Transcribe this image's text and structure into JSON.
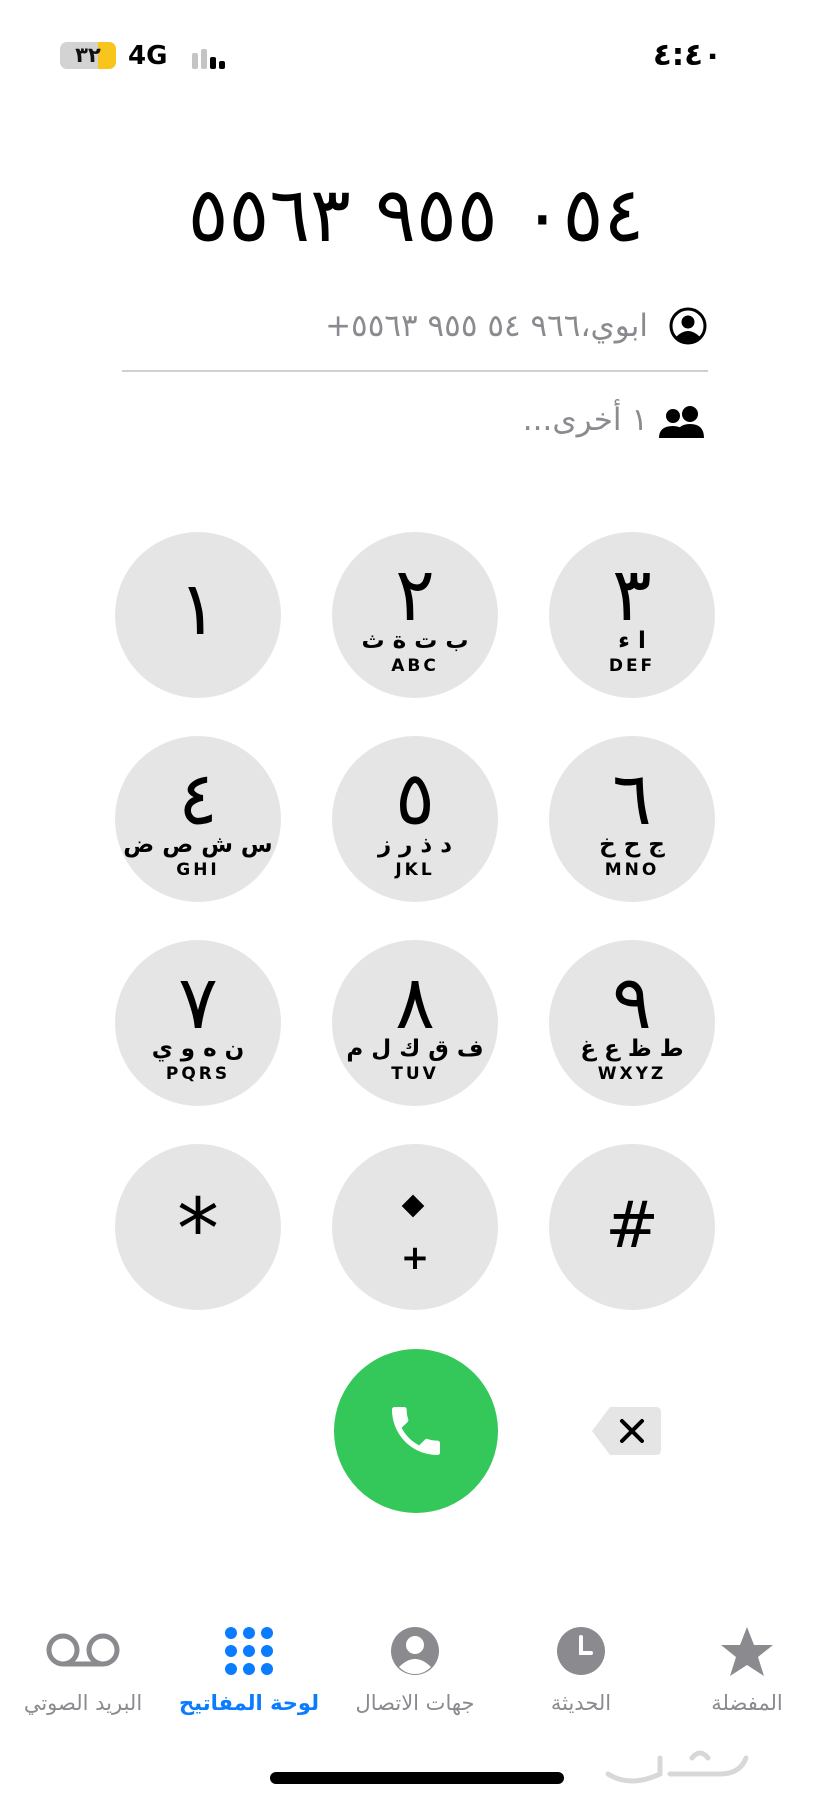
{
  "status_bar": {
    "time": "٤:٤٠",
    "network": "4G",
    "battery": "٣٢",
    "battery_color": "#f8c51c"
  },
  "dialer": {
    "number": "٠٥٤ ٩٥٥ ٥٥٦٣",
    "contact_match": "ابوي،٦٣‏ ٥٥٥ ٩٥٥ ٥٤ ٩٦٦+",
    "contact_name": "ابوي",
    "contact_number": "+٩٦٦ ٥٤ ٩٥٥ ٥٥٦٣",
    "others": "١ أخرى...",
    "icons": {
      "contact": "person-circle-icon",
      "others": "group-icon",
      "call": "phone-icon",
      "delete": "delete-backspace-icon"
    }
  },
  "keypad": {
    "keys": [
      {
        "digit": "١",
        "arabic": "",
        "latin": ""
      },
      {
        "digit": "٢",
        "arabic": "ب ت ة ث",
        "latin": "ABC"
      },
      {
        "digit": "٣",
        "arabic": "ا ء",
        "latin": "DEF"
      },
      {
        "digit": "٤",
        "arabic": "س ش ص ض",
        "latin": "GHI"
      },
      {
        "digit": "٥",
        "arabic": "د ذ ر ز",
        "latin": "JKL"
      },
      {
        "digit": "٦",
        "arabic": "ج ح خ",
        "latin": "MNO"
      },
      {
        "digit": "٧",
        "arabic": "ن ه و ي",
        "latin": "PQRS"
      },
      {
        "digit": "٨",
        "arabic": "ف ق ك ل م",
        "latin": "TUV"
      },
      {
        "digit": "٩",
        "arabic": "ط ظ ع غ",
        "latin": "WXYZ"
      },
      {
        "digit": "*"
      },
      {
        "digit": "٠",
        "sub": "+"
      },
      {
        "digit": "#"
      }
    ],
    "key_color": "#e5e5e5",
    "call_color": "#34c759"
  },
  "tab_bar": {
    "voicemail": "البريد الصوتي",
    "keypad": "لوحة المفاتيح",
    "contacts": "جهات الاتصال",
    "recents": "الحديثة",
    "favorites": "المفضلة",
    "active_color": "#0a7cff",
    "inactive_color": "#8a8a8f"
  }
}
